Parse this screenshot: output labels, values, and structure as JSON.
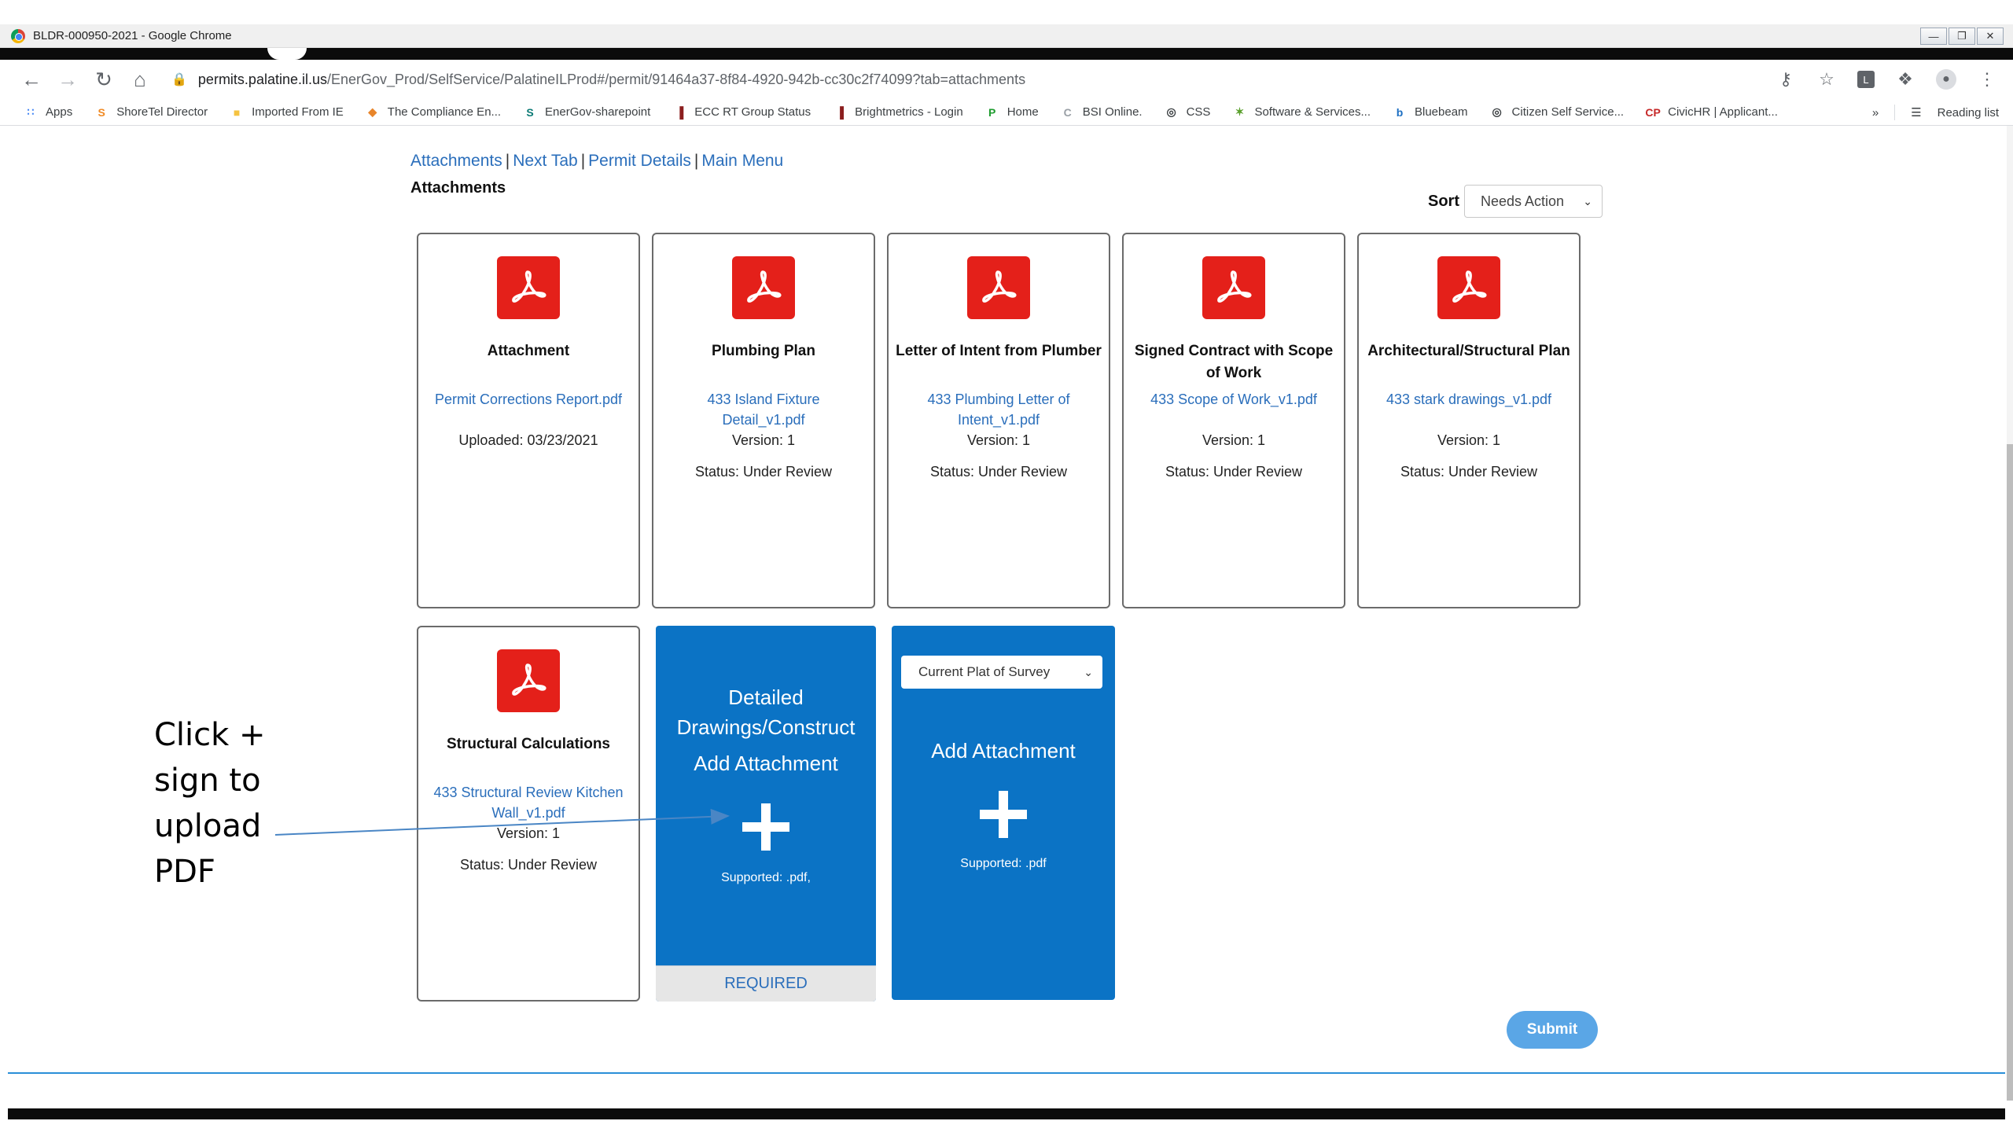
{
  "browser": {
    "window_title": "BLDR-000950-2021 - Google Chrome",
    "url_host": "permits.palatine.il.us",
    "url_path": "/EnerGov_Prod/SelfService/PalatineILProd#/permit/91464a37-8f84-4920-942b-cc30c2f74099?tab=attachments",
    "bookmarks": [
      {
        "label": "Apps",
        "icon": "apps-grid-icon",
        "color": "#4285f4"
      },
      {
        "label": "ShoreTel Director",
        "icon": "shoretel-icon",
        "color": "#f08a24"
      },
      {
        "label": "Imported From IE",
        "icon": "folder-icon",
        "color": "#f5c342"
      },
      {
        "label": "The Compliance En...",
        "icon": "compliance-icon",
        "color": "#e8852b"
      },
      {
        "label": "EnerGov-sharepoint",
        "icon": "sharepoint-icon",
        "color": "#0b7a75"
      },
      {
        "label": "ECC RT Group Status",
        "icon": "chart-bars-icon",
        "color": "#8b1e1e"
      },
      {
        "label": "Brightmetrics - Login",
        "icon": "chart-bars-icon",
        "color": "#8b1e1e"
      },
      {
        "label": "Home",
        "icon": "home-green-icon",
        "color": "#1e9c2f"
      },
      {
        "label": "BSI Online.",
        "icon": "bsi-icon",
        "color": "#9aa0a6"
      },
      {
        "label": "CSS",
        "icon": "globe-icon",
        "color": "#3c4043"
      },
      {
        "label": "Software & Services...",
        "icon": "software-icon",
        "color": "#5aa02c"
      },
      {
        "label": "Bluebeam",
        "icon": "bluebeam-icon",
        "color": "#1b6ec2"
      },
      {
        "label": "Citizen Self Service...",
        "icon": "globe-icon",
        "color": "#3c4043"
      },
      {
        "label": "CivicHR | Applicant...",
        "icon": "civichr-icon",
        "color": "#c62828"
      }
    ],
    "more_bookmarks": "»",
    "reading_list": "Reading list"
  },
  "page": {
    "nav_links": [
      "Attachments",
      "Next Tab",
      "Permit Details",
      "Main Menu"
    ],
    "nav_separator": "|",
    "section_title": "Attachments",
    "sort_label": "Sort",
    "sort_value": "Needs Action",
    "cards": [
      {
        "title": "Attachment",
        "file": "Permit Corrections Report.pdf",
        "line1": "Uploaded: 03/23/2021",
        "line2": ""
      },
      {
        "title": "Plumbing Plan",
        "file": "433 Island Fixture Detail_v1.pdf",
        "line1": "Version: 1",
        "line2": "Status: Under Review"
      },
      {
        "title": "Letter of Intent from Plumber",
        "file": "433 Plumbing Letter of Intent_v1.pdf",
        "line1": "Version: 1",
        "line2": "Status: Under Review"
      },
      {
        "title": "Signed Contract with Scope of Work",
        "file": "433 Scope of Work_v1.pdf",
        "line1": "Version: 1",
        "line2": "Status: Under Review"
      },
      {
        "title": "Architectural/Structural Plan",
        "file": "433 stark drawings_v1.pdf",
        "line1": "Version: 1",
        "line2": "Status: Under Review"
      },
      {
        "title": "Structural Calculations",
        "file": "433 Structural Review Kitchen Wall_v1.pdf",
        "line1": "Version: 1",
        "line2": "Status: Under Review"
      }
    ],
    "upload_required": {
      "title": "Detailed Drawings/Construct",
      "action": "Add Attachment",
      "supported": "Supported: .pdf,",
      "badge": "REQUIRED"
    },
    "upload_optional": {
      "type_select": "Current Plat of Survey",
      "action": "Add Attachment",
      "supported": "Supported: .pdf"
    },
    "submit_label": "Submit"
  },
  "annotation": {
    "lines": [
      "Click +",
      "sign to",
      "upload",
      "PDF"
    ],
    "arrow_color": "#4a86c5"
  },
  "colors": {
    "accent_blue": "#0b73c5",
    "link_blue": "#2a6ebb",
    "pdf_red": "#e4201a",
    "submit_blue": "#5aa6e6"
  }
}
